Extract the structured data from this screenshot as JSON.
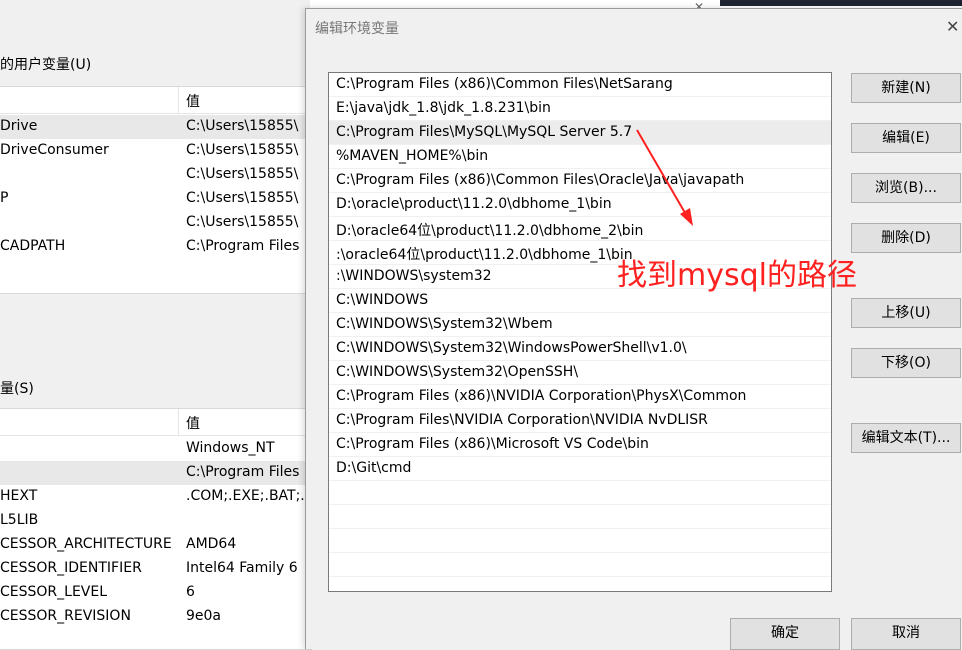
{
  "background_window": {
    "user_vars_label": "的用户变量(U)",
    "user_header_value": "值",
    "user_vars": [
      {
        "name": "Drive",
        "value": "C:\\Users\\15855\\"
      },
      {
        "name": "DriveConsumer",
        "value": "C:\\Users\\15855\\"
      },
      {
        "name": "",
        "value": "C:\\Users\\15855\\"
      },
      {
        "name": "P",
        "value": "C:\\Users\\15855\\"
      },
      {
        "name": "",
        "value": "C:\\Users\\15855\\"
      },
      {
        "name": "CADPATH",
        "value": "C:\\Program Files"
      }
    ],
    "system_vars_label": "量(S)",
    "system_header_value": "值",
    "system_vars": [
      {
        "name": "",
        "value": "Windows_NT"
      },
      {
        "name": "",
        "value": "C:\\Program Files"
      },
      {
        "name": "HEXT",
        "value": ".COM;.EXE;.BAT;."
      },
      {
        "name": "L5LIB",
        "value": ""
      },
      {
        "name": "CESSOR_ARCHITECTURE",
        "value": "AMD64"
      },
      {
        "name": "CESSOR_IDENTIFIER",
        "value": "Intel64 Family 6"
      },
      {
        "name": "CESSOR_LEVEL",
        "value": "6"
      },
      {
        "name": "CESSOR_REVISION",
        "value": "9e0a"
      }
    ]
  },
  "dialog": {
    "title": "编辑环境变量",
    "close_glyph": "✕",
    "paths": [
      "C:\\Program Files (x86)\\Common Files\\NetSarang",
      "E:\\java\\jdk_1.8\\jdk_1.8.231\\bin",
      "C:\\Program Files\\MySQL\\MySQL Server 5.7",
      "%MAVEN_HOME%\\bin",
      "C:\\Program Files (x86)\\Common Files\\Oracle\\Java\\javapath",
      "D:\\oracle\\product\\11.2.0\\dbhome_1\\bin",
      "D:\\oracle64位\\product\\11.2.0\\dbhome_2\\bin",
      ":\\oracle64位\\product\\11.2.0\\dbhome_1\\bin",
      ":\\WINDOWS\\system32",
      "C:\\WINDOWS",
      "C:\\WINDOWS\\System32\\Wbem",
      "C:\\WINDOWS\\System32\\WindowsPowerShell\\v1.0\\",
      "C:\\WINDOWS\\System32\\OpenSSH\\",
      "C:\\Program Files (x86)\\NVIDIA Corporation\\PhysX\\Common",
      "C:\\Program Files\\NVIDIA Corporation\\NVIDIA NvDLISR",
      "C:\\Program Files (x86)\\Microsoft VS Code\\bin",
      "D:\\Git\\cmd",
      "",
      "",
      "",
      "",
      ""
    ],
    "selected_index": 2,
    "buttons": {
      "new": "新建(N)",
      "edit": "编辑(E)",
      "browse": "浏览(B)...",
      "delete": "删除(D)",
      "move_up": "上移(U)",
      "move_down": "下移(O)",
      "edit_text": "编辑文本(T)...",
      "ok": "确定",
      "cancel": "取消"
    },
    "annotation": {
      "text": "找到mysql的路径",
      "color": "#ff2020"
    }
  }
}
